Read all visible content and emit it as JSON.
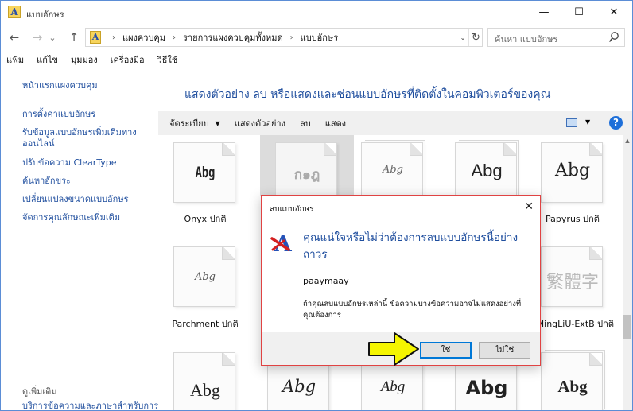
{
  "window": {
    "title": "แบบอักษร",
    "minimize_glyph": "—",
    "maximize_glyph": "☐",
    "close_glyph": "✕"
  },
  "nav": {
    "back_glyph": "←",
    "forward_glyph": "→",
    "recent_glyph": "⌄",
    "up_glyph": "↑",
    "refresh_glyph": "↻",
    "dropdown_glyph": "⌄",
    "breadcrumb_sep": "›",
    "breadcrumbs": [
      "แผงควบคุม",
      "รายการแผงควบคุมทั้งหมด",
      "แบบอักษร"
    ],
    "search_placeholder": "ค้นหา แบบอักษร"
  },
  "menu": [
    "แฟ้ม",
    "แก้ไข",
    "มุมมอง",
    "เครื่องมือ",
    "วิธีใช้"
  ],
  "left_pane": {
    "home_link": "หน้าแรกแผงควบคุม",
    "links": [
      "การตั้งค่าแบบอักษร",
      "รับข้อมูลแบบอักษรเพิ่มเติมทางออนไลน์",
      "ปรับข้อความ ClearType",
      "ค้นหาอักขระ",
      "เปลี่ยนแปลงขนาดแบบอักษร",
      "จัดการคุณลักษณะเพิ่มเติม"
    ],
    "see_also_heading": "ดูเพิ่มเติม",
    "see_also_link": "บริการข้อความและภาษาสำหรับการ"
  },
  "main": {
    "title": "แสดงตัวอย่าง ลบ หรือแสดงและซ่อนแบบอักษรที่ติดตั้งในคอมพิวเตอร์ของคุณ",
    "toolbar": {
      "organize": "จัดระเบียบ",
      "organize_caret": "▼",
      "preview": "แสดงตัวอย่าง",
      "delete": "ลบ",
      "show": "แสดง",
      "view_caret": "▼",
      "help": "?"
    }
  },
  "fonts": [
    {
      "sample": "Abg",
      "label": "Onyx ปกติ"
    },
    {
      "sample": "ก๑ฎ",
      "label": ""
    },
    {
      "sample": "Abg",
      "label": ""
    },
    {
      "sample": "Abg",
      "label": ""
    },
    {
      "sample": "Abg",
      "label": "Papyrus ปกติ"
    },
    {
      "sample": "Abg",
      "label": "Parchment ปกติ"
    },
    {
      "sample": "繁體字",
      "label": "PMingLiU-ExtB ปกติ"
    },
    {
      "sample": "Abg",
      "label": ""
    },
    {
      "sample": "Abg",
      "label": ""
    },
    {
      "sample": "Abg",
      "label": ""
    },
    {
      "sample": "Abg",
      "label": ""
    },
    {
      "sample": "Abg",
      "label": ""
    }
  ],
  "dialog": {
    "title": "ลบแบบอักษร",
    "close_glyph": "✕",
    "question": "คุณแน่ใจหรือไม่ว่าต้องการลบแบบอักษรนี้อย่างถาวร",
    "font_name": "paaymaay",
    "info": "ถ้าคุณลบแบบอักษรเหล่านี้ ข้อความบางข้อความอาจไม่แสดงอย่างที่คุณต้องการ",
    "yes": "ใช่",
    "no": "ไม่ใช่"
  },
  "colors": {
    "link": "#1f4e9e",
    "dialog_border": "#e04343",
    "arrow_fill": "#f5f500",
    "help_blue": "#1e6fd9"
  }
}
